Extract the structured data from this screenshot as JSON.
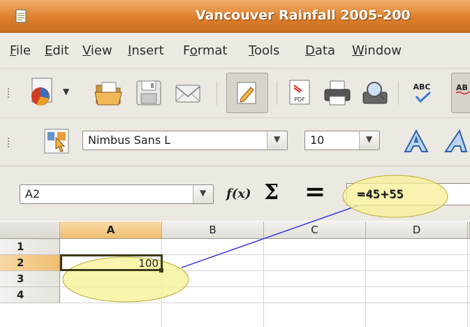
{
  "window": {
    "title": "Vancouver Rainfall 2005-200"
  },
  "menu": [
    {
      "mnemonic": "F",
      "rest": "ile"
    },
    {
      "mnemonic": "E",
      "rest": "dit"
    },
    {
      "mnemonic": "V",
      "rest": "iew"
    },
    {
      "mnemonic": "I",
      "rest": "nsert"
    },
    {
      "pre": "F",
      "mnemonic": "o",
      "rest": "rmat"
    },
    {
      "mnemonic": "T",
      "rest": "ools"
    },
    {
      "mnemonic": "D",
      "rest": "ata"
    },
    {
      "mnemonic": "W",
      "rest": "indow"
    }
  ],
  "toolbar": {
    "pdf_icon_label": "PDF",
    "spell_icon_label": "ABC",
    "spell_icon_label2": "AB"
  },
  "format": {
    "font_name": "Nimbus Sans L",
    "font_size": "10"
  },
  "formula": {
    "name_box": "A2",
    "fx": "f(x)",
    "sum": "Σ",
    "equals": "=",
    "content": "=45+55"
  },
  "sheet": {
    "columns": [
      "A",
      "B",
      "C",
      "D"
    ],
    "rows": [
      "1",
      "2",
      "3",
      "4"
    ],
    "active_cell": "A2",
    "cells": {
      "A2": "100"
    }
  },
  "colors": {
    "title_bar": "#dd7f2c",
    "highlight_fill": "#f8f19a",
    "callout_line": "#3b39e6",
    "active_cell_border": "#3d3a17"
  }
}
